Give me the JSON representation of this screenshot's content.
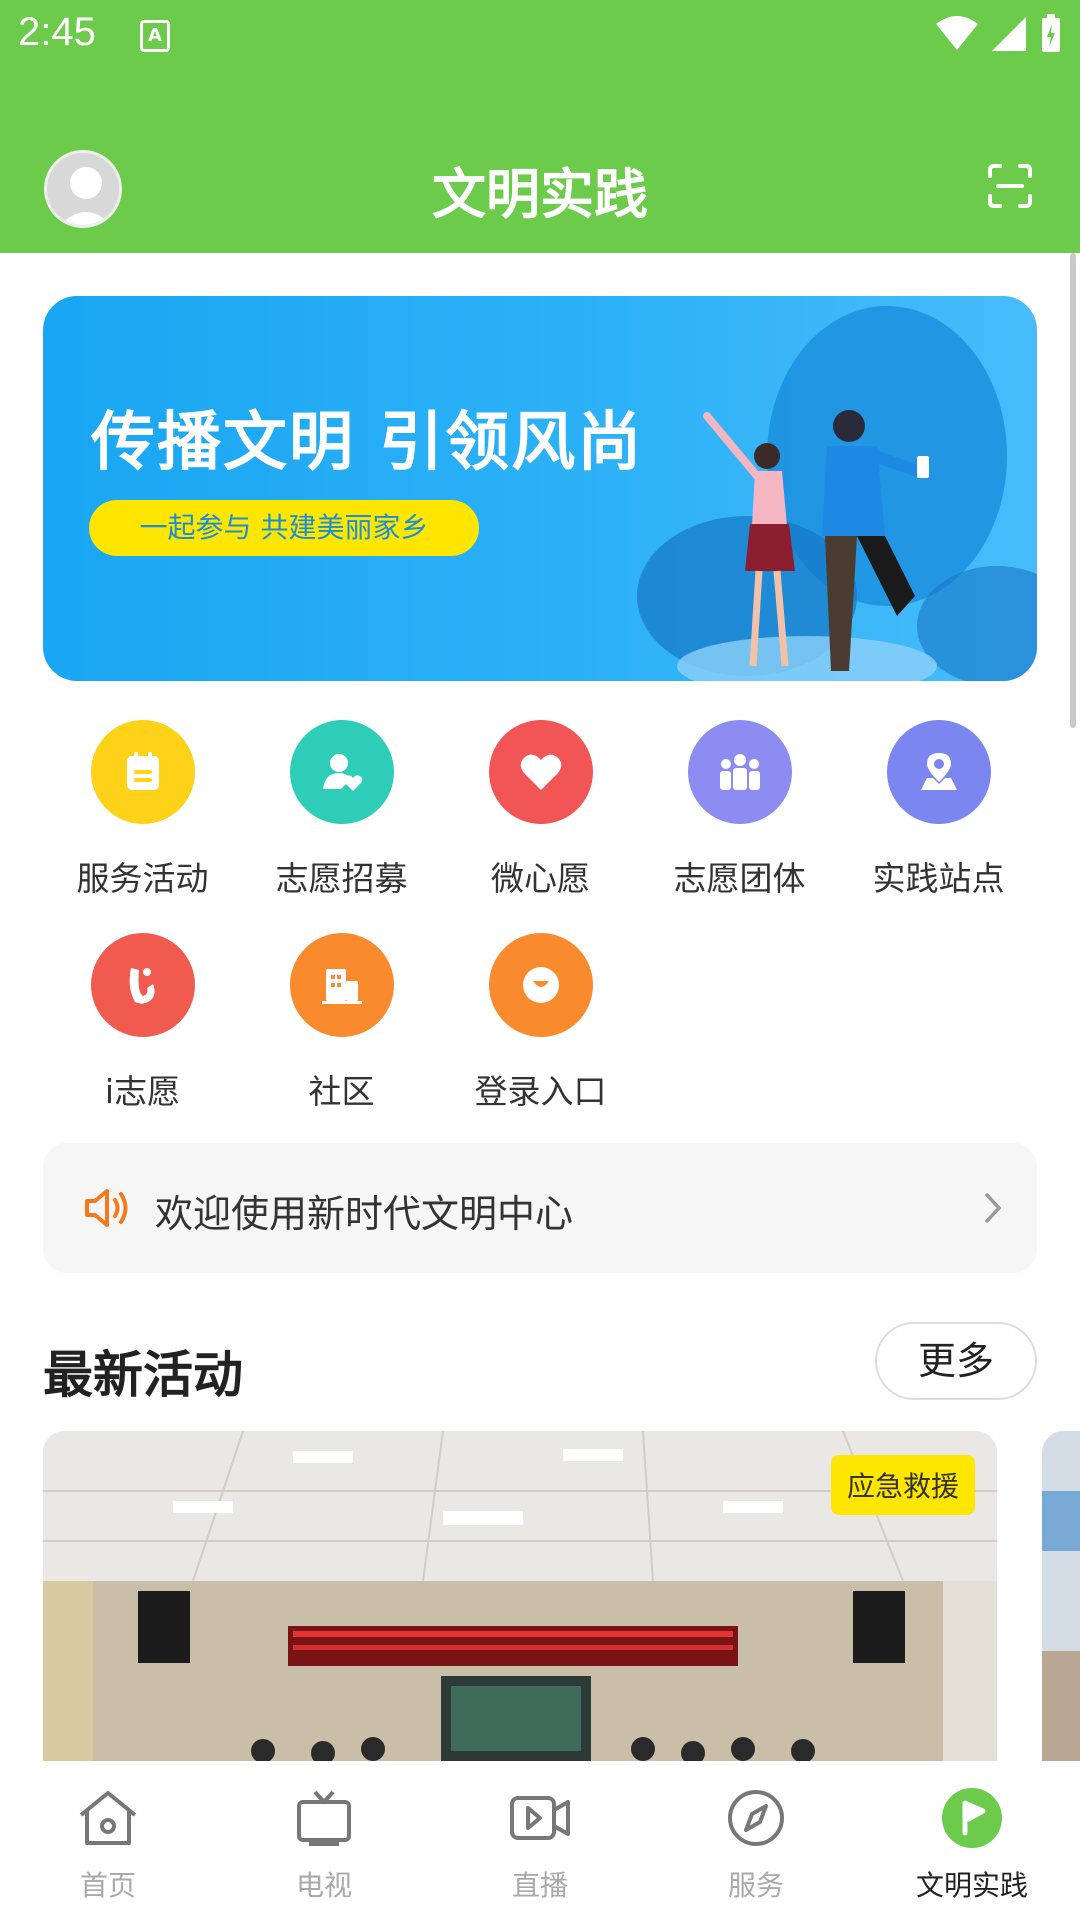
{
  "status_bar": {
    "time": "2:45",
    "notification_letter": "A"
  },
  "header": {
    "title": "文明实践",
    "avatar_icon": "user-avatar-icon",
    "scan_icon": "scan-icon"
  },
  "banner": {
    "headline": "传播文明 引领风尚",
    "tagline": "一起参与 共建美丽家乡"
  },
  "grid": [
    {
      "label": "服务活动",
      "color": "#FFD21A",
      "icon": "clipboard-icon"
    },
    {
      "label": "志愿招募",
      "color": "#2DCDB8",
      "icon": "person-heart-icon"
    },
    {
      "label": "微心愿",
      "color": "#F25555",
      "icon": "heart-icon"
    },
    {
      "label": "志愿团体",
      "color": "#8C8CF2",
      "icon": "group-icon"
    },
    {
      "label": "实践站点",
      "color": "#7B86F0",
      "icon": "location-pin-icon"
    },
    {
      "label": "i志愿",
      "color": "#F05A4F",
      "icon": "i-volunteer-icon"
    },
    {
      "label": "社区",
      "color": "#FA8A2E",
      "icon": "building-icon"
    },
    {
      "label": "登录入口",
      "color": "#FA8A2E",
      "icon": "login-icon"
    }
  ],
  "notice": {
    "text": "欢迎使用新时代文明中心",
    "icon": "speaker-icon"
  },
  "latest": {
    "title": "最新活动",
    "more_label": "更多",
    "cards": [
      {
        "tag": "应急救援"
      }
    ]
  },
  "bottom_nav": [
    {
      "label": "首页",
      "icon": "home-icon",
      "active": false
    },
    {
      "label": "电视",
      "icon": "tv-icon",
      "active": false
    },
    {
      "label": "直播",
      "icon": "live-video-icon",
      "active": false
    },
    {
      "label": "服务",
      "icon": "compass-icon",
      "active": false
    },
    {
      "label": "文明实践",
      "icon": "flag-icon",
      "active": true
    }
  ],
  "colors": {
    "primary_green": "#6CCB4A",
    "banner_blue": "#1EA9F4",
    "badge_yellow": "#FFE600"
  }
}
